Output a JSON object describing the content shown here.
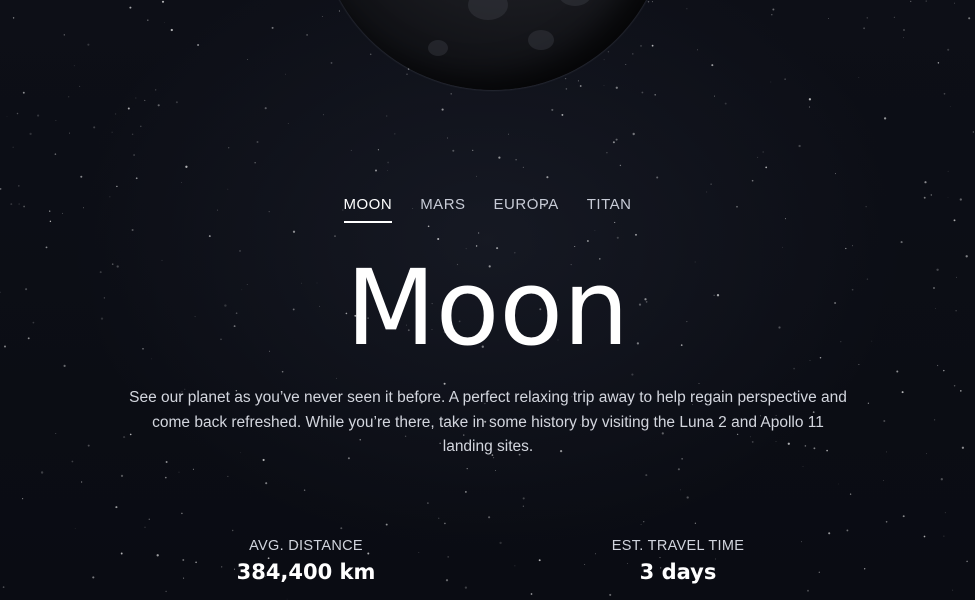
{
  "nav": {
    "tabs": [
      {
        "label": "MOON",
        "active": true
      },
      {
        "label": "MARS",
        "active": false
      },
      {
        "label": "EUROPA",
        "active": false
      },
      {
        "label": "TITAN",
        "active": false
      }
    ]
  },
  "destination": {
    "name": "Moon",
    "description": "See our planet as you’ve never seen it before. A perfect relaxing trip away to help regain perspective and come back refreshed. While you’re there, take in some history by visiting the Luna 2 and Apollo 11 landing sites."
  },
  "stats": {
    "distance": {
      "label": "AVG. DISTANCE",
      "value": "384,400 km"
    },
    "travel": {
      "label": "EST. TRAVEL TIME",
      "value": "3 days"
    }
  },
  "colors": {
    "background": "#0b0d14",
    "text": "#ffffff",
    "muted": "#c7cbd6"
  }
}
